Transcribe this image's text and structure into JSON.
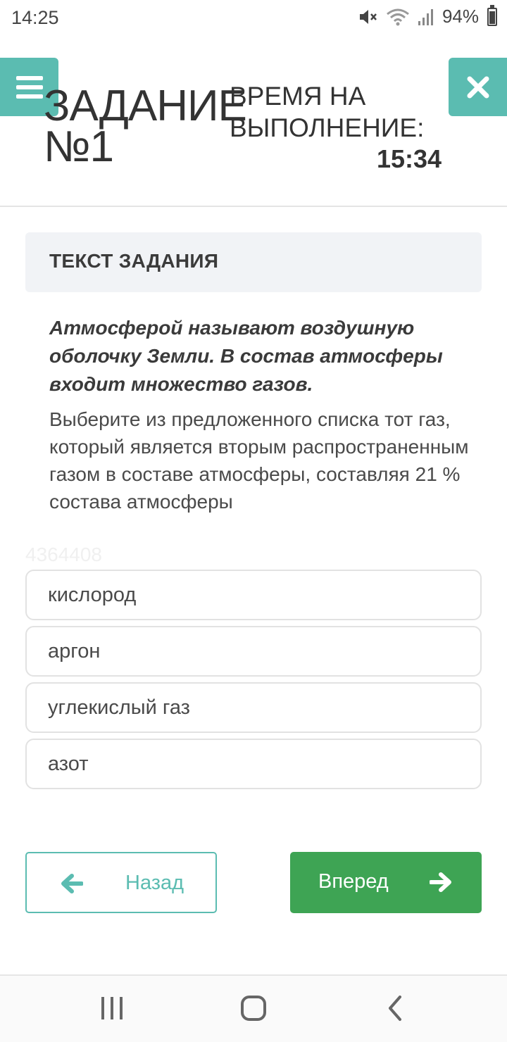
{
  "status_bar": {
    "time": "14:25",
    "battery": "94%",
    "icons": [
      "mute-icon",
      "wifi-icon",
      "signal-icon",
      "battery-icon"
    ]
  },
  "header": {
    "title": "ЗАДАНИЕ №1",
    "time_label": "ВРЕМЯ НА ВЫПОЛНЕНИЕ:",
    "time_value": "15:34",
    "menu_icon": "menu-icon",
    "close_icon": "close-icon",
    "accent_color": "#5bbcb1"
  },
  "task": {
    "heading": "ТЕКСТ ЗАДАНИЯ",
    "bold_text": "Атмосферой называют воздушную оболочку Земли. В состав атмосферы входит множество газов.",
    "question": "Выберите из предложенного списка тот газ, который является вторым распространенным газом в составе атмосферы, составляя 21 % состава атмосферы",
    "watermark": "4364408"
  },
  "options": [
    {
      "label": "кислород"
    },
    {
      "label": "аргон"
    },
    {
      "label": "углекислый газ"
    },
    {
      "label": "азот"
    }
  ],
  "navigation": {
    "back_label": "Назад",
    "next_label": "Вперед",
    "next_color": "#3ea454"
  },
  "system_nav": {
    "recent_icon": "recent-apps-icon",
    "home_icon": "home-icon",
    "back_icon": "back-icon"
  }
}
